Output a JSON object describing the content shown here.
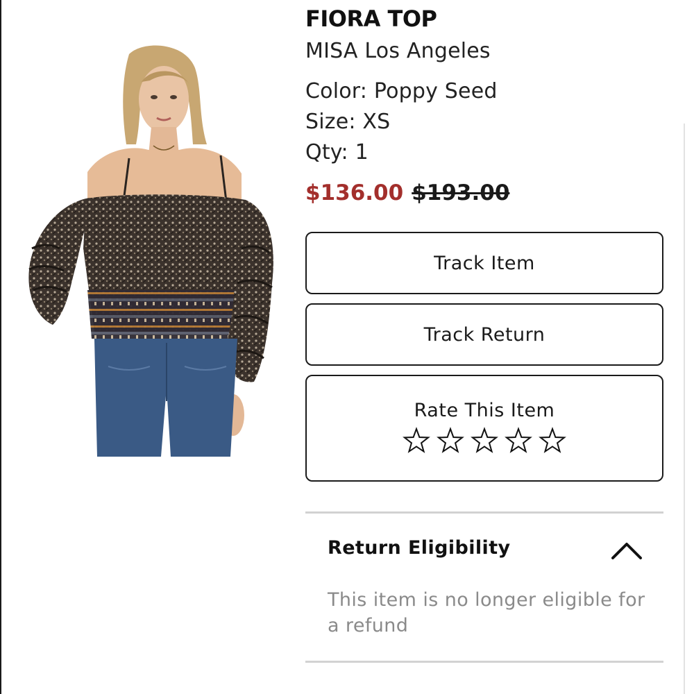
{
  "product": {
    "title": "FIORA TOP",
    "brand": "MISA Los Angeles",
    "color_line": "Color: Poppy Seed",
    "size_line": "Size: XS",
    "qty_line": "Qty: 1",
    "sale_price": "$136.00",
    "original_price": "$193.00",
    "image_icon": "product-photo"
  },
  "actions": {
    "track_item": "Track Item",
    "track_return": "Track Return",
    "rate_item": "Rate This Item",
    "star_count": 5,
    "star_rating": 0
  },
  "return_section": {
    "title": "Return Eligibility",
    "body": "This item is no longer eligible for a refund",
    "expanded": true
  },
  "colors": {
    "sale_price": "#a32f2c",
    "text": "#111111",
    "muted": "#8a8a8a",
    "border": "#1a1a1a",
    "divider": "#d2d2d2"
  }
}
